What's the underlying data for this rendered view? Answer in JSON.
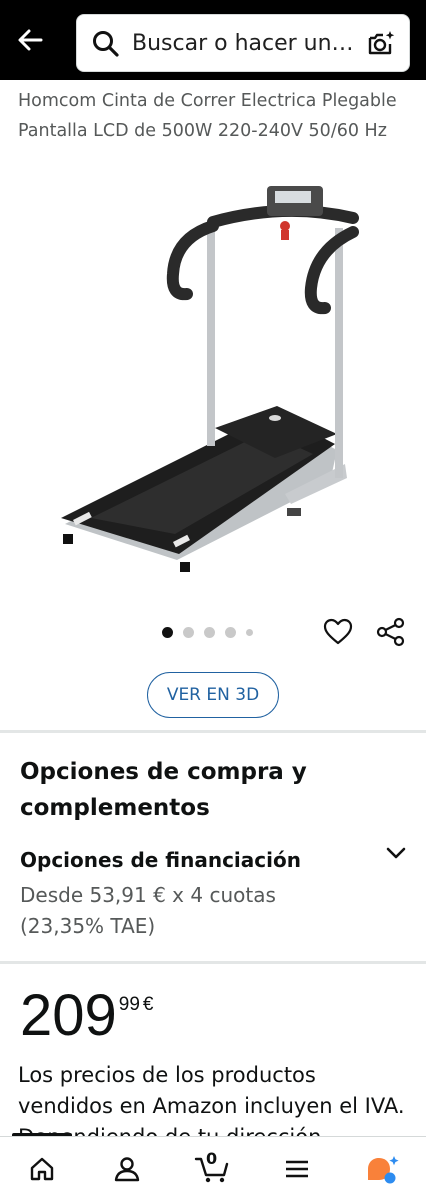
{
  "header": {
    "search_text": "Buscar o hacer una pregunta",
    "icons": [
      "back-arrow-icon",
      "search-icon",
      "camera-icon"
    ]
  },
  "product": {
    "title": "Homcom Cinta de Correr Electrica Plegable Pantalla LCD de 500W 220-240V 50/60 Hz",
    "image_icon": "treadmill-image",
    "carousel_dots": 5,
    "active_dot": 0,
    "view_3d_label": "VER EN 3D"
  },
  "purchase_options": {
    "heading": "Opciones de compra y complementos",
    "financing_title": "Opciones de financiación",
    "financing_desc": "Desde 53,91 € x 4 cuotas (23,35% TAE)"
  },
  "price": {
    "whole": "209",
    "fraction": "99",
    "currency": "€",
    "note": "Los precios de los productos vendidos en Amazon incluyen el IVA. Dependiendo de tu dirección"
  },
  "bottom_nav": {
    "cart_count": "0",
    "items": [
      "home-icon",
      "account-icon",
      "cart-icon",
      "menu-icon",
      "rufus-icon"
    ]
  },
  "colors": {
    "topbar": "#000000",
    "link_blue": "#2162a1",
    "text_primary": "#0f1111",
    "text_secondary": "#565959",
    "rufus_orange": "#f9813a",
    "rufus_blue": "#2d8cf0"
  }
}
